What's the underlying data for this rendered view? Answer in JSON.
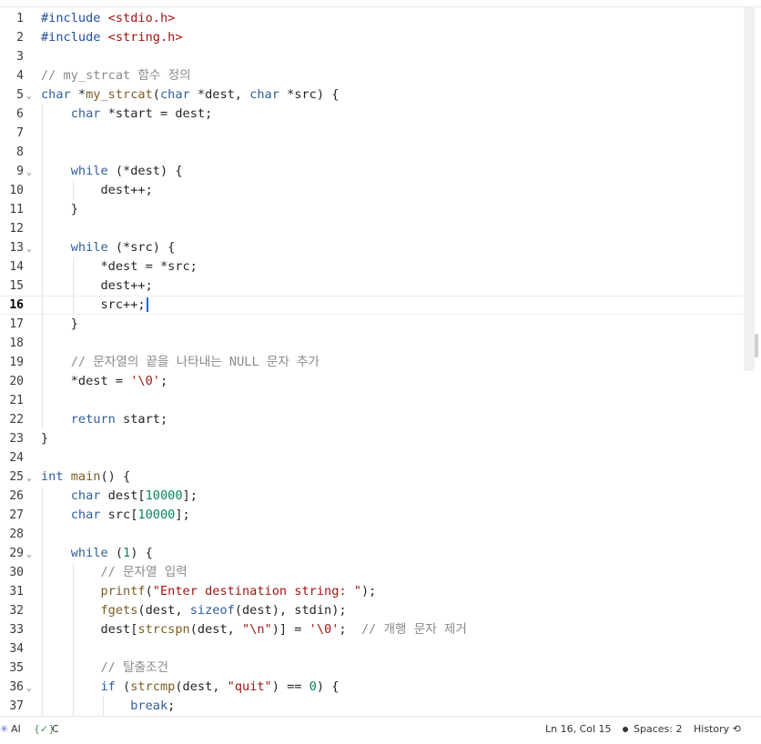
{
  "editor": {
    "current_line": 16,
    "lines": [
      [
        {
          "t": "#include ",
          "c": "pp"
        },
        {
          "t": "<stdio.h>",
          "c": "str"
        }
      ],
      [
        {
          "t": "#include ",
          "c": "pp"
        },
        {
          "t": "<string.h>",
          "c": "str"
        }
      ],
      [],
      [
        {
          "t": "// my_strcat 함수 정의",
          "c": "cmt"
        }
      ],
      [
        {
          "t": "char ",
          "c": "kw"
        },
        {
          "t": "*"
        },
        {
          "t": "my_strcat",
          "c": "fn"
        },
        {
          "t": "("
        },
        {
          "t": "char ",
          "c": "kw"
        },
        {
          "t": "*dest, "
        },
        {
          "t": "char ",
          "c": "kw"
        },
        {
          "t": "*src) {"
        }
      ],
      [
        {
          "t": "    "
        },
        {
          "t": "char ",
          "c": "kw"
        },
        {
          "t": "*start = dest;"
        }
      ],
      [],
      [],
      [
        {
          "t": "    "
        },
        {
          "t": "while",
          "c": "kw"
        },
        {
          "t": " (*dest) {"
        }
      ],
      [
        {
          "t": "        dest++;"
        }
      ],
      [
        {
          "t": "    }"
        }
      ],
      [],
      [
        {
          "t": "    "
        },
        {
          "t": "while",
          "c": "kw"
        },
        {
          "t": " (*src) {"
        }
      ],
      [
        {
          "t": "        *dest = *src;"
        }
      ],
      [
        {
          "t": "        dest++;"
        }
      ],
      [
        {
          "t": "        src++;"
        }
      ],
      [
        {
          "t": "    }"
        }
      ],
      [],
      [
        {
          "t": "    "
        },
        {
          "t": "// 문자열의 끝을 나타내는 NULL 문자 추가",
          "c": "cmt"
        }
      ],
      [
        {
          "t": "    *dest = "
        },
        {
          "t": "'\\0'",
          "c": "str"
        },
        {
          "t": ";"
        }
      ],
      [],
      [
        {
          "t": "    "
        },
        {
          "t": "return",
          "c": "kw"
        },
        {
          "t": " start;"
        }
      ],
      [
        {
          "t": "}"
        }
      ],
      [],
      [
        {
          "t": "int ",
          "c": "kw"
        },
        {
          "t": "main",
          "c": "fn"
        },
        {
          "t": "() {"
        }
      ],
      [
        {
          "t": "    "
        },
        {
          "t": "char ",
          "c": "kw"
        },
        {
          "t": "dest["
        },
        {
          "t": "10000",
          "c": "num"
        },
        {
          "t": "];"
        }
      ],
      [
        {
          "t": "    "
        },
        {
          "t": "char ",
          "c": "kw"
        },
        {
          "t": "src["
        },
        {
          "t": "10000",
          "c": "num"
        },
        {
          "t": "];"
        }
      ],
      [],
      [
        {
          "t": "    "
        },
        {
          "t": "while",
          "c": "kw"
        },
        {
          "t": " ("
        },
        {
          "t": "1",
          "c": "num"
        },
        {
          "t": ") {"
        }
      ],
      [
        {
          "t": "        "
        },
        {
          "t": "// 문자열 입력",
          "c": "cmt"
        }
      ],
      [
        {
          "t": "        "
        },
        {
          "t": "printf",
          "c": "fn"
        },
        {
          "t": "("
        },
        {
          "t": "\"Enter destination string: \"",
          "c": "str"
        },
        {
          "t": ");"
        }
      ],
      [
        {
          "t": "        "
        },
        {
          "t": "fgets",
          "c": "fn"
        },
        {
          "t": "(dest, "
        },
        {
          "t": "sizeof",
          "c": "kw"
        },
        {
          "t": "(dest), stdin);"
        }
      ],
      [
        {
          "t": "        dest["
        },
        {
          "t": "strcspn",
          "c": "fn"
        },
        {
          "t": "(dest, "
        },
        {
          "t": "\"\\n\"",
          "c": "str"
        },
        {
          "t": ")] = "
        },
        {
          "t": "'\\0'",
          "c": "str"
        },
        {
          "t": ";  "
        },
        {
          "t": "// 개행 문자 제거",
          "c": "cmt"
        }
      ],
      [],
      [
        {
          "t": "        "
        },
        {
          "t": "// 탈출조건",
          "c": "cmt"
        }
      ],
      [
        {
          "t": "        "
        },
        {
          "t": "if",
          "c": "kw"
        },
        {
          "t": " ("
        },
        {
          "t": "strcmp",
          "c": "fn"
        },
        {
          "t": "(dest, "
        },
        {
          "t": "\"quit\"",
          "c": "str"
        },
        {
          "t": ") == "
        },
        {
          "t": "0",
          "c": "num"
        },
        {
          "t": ") {"
        }
      ],
      [
        {
          "t": "            "
        },
        {
          "t": "break",
          "c": "kw"
        },
        {
          "t": ";"
        }
      ]
    ],
    "fold_lines": [
      5,
      9,
      13,
      25,
      29,
      36
    ],
    "fold_glyph": "⌄",
    "guides": {
      "6": [
        1
      ],
      "7": [
        1
      ],
      "8": [
        1
      ],
      "9": [
        1
      ],
      "10": [
        1,
        2
      ],
      "11": [
        1
      ],
      "12": [
        1
      ],
      "13": [
        1
      ],
      "14": [
        1,
        2
      ],
      "15": [
        1,
        2
      ],
      "16": [
        1,
        2
      ],
      "17": [
        1
      ],
      "18": [
        1
      ],
      "19": [
        1
      ],
      "20": [
        1
      ],
      "21": [
        1
      ],
      "22": [
        1
      ],
      "26": [
        1
      ],
      "27": [
        1
      ],
      "28": [
        1
      ],
      "29": [
        1
      ],
      "30": [
        1,
        2
      ],
      "31": [
        1,
        2
      ],
      "32": [
        1,
        2
      ],
      "33": [
        1,
        2
      ],
      "34": [
        1,
        2
      ],
      "35": [
        1,
        2
      ],
      "36": [
        1,
        2
      ],
      "37": [
        1,
        2,
        3
      ]
    }
  },
  "statusbar": {
    "ai_label": "AI",
    "ai_icon": "sparkle-icon",
    "language_icon": "braces-check-icon",
    "language_icon_glyph": "{✓}",
    "language": "C",
    "position": "Ln 16, Col 15",
    "spaces": "Spaces: 2",
    "history": "History",
    "history_icon_glyph": "⟲"
  },
  "colors": {
    "keyword": "#2f5d9e",
    "function": "#795e26",
    "comment": "#8a8a8a",
    "string": "#a31515",
    "number": "#098658",
    "cursor": "#1a66d6"
  }
}
